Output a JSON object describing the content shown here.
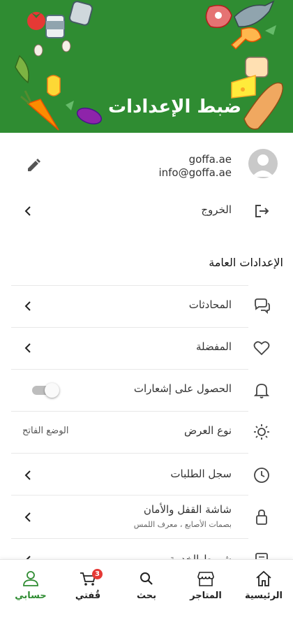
{
  "header": {
    "title": "ضبط الإعدادات"
  },
  "profile": {
    "name": "goffa.ae",
    "email": "info@goffa.ae"
  },
  "logout": {
    "label": "الخروج"
  },
  "general": {
    "title": "الإعدادات العامة",
    "items": [
      {
        "label": "المحادثات",
        "icon": "chat-icon"
      },
      {
        "label": "المفضلة",
        "icon": "heart-icon"
      },
      {
        "label": "الحصول على إشعارات",
        "icon": "bell-icon",
        "toggle": false
      },
      {
        "label": "نوع العرض",
        "icon": "sun-icon",
        "value": "الوضع الفاتح"
      },
      {
        "label": "سجل الطلبات",
        "icon": "clock-icon"
      },
      {
        "label": "شاشة القفل والأمان",
        "sub": "بصمات الأصابع ، معرف اللمس",
        "icon": "lock-icon"
      },
      {
        "label": "شروط الخدمة",
        "icon": "document-icon"
      }
    ]
  },
  "bottom_nav": {
    "items": [
      {
        "label": "الرئيسية",
        "icon": "home-icon"
      },
      {
        "label": "المتاجر",
        "icon": "store-icon"
      },
      {
        "label": "بحث",
        "icon": "search-icon"
      },
      {
        "label": "قُفتي",
        "icon": "cart-icon",
        "badge": "3"
      },
      {
        "label": "حسابي",
        "icon": "user-icon",
        "active": true
      }
    ]
  },
  "colors": {
    "brand": "#2f8c32",
    "badge": "#e53935",
    "text": "#333333"
  }
}
